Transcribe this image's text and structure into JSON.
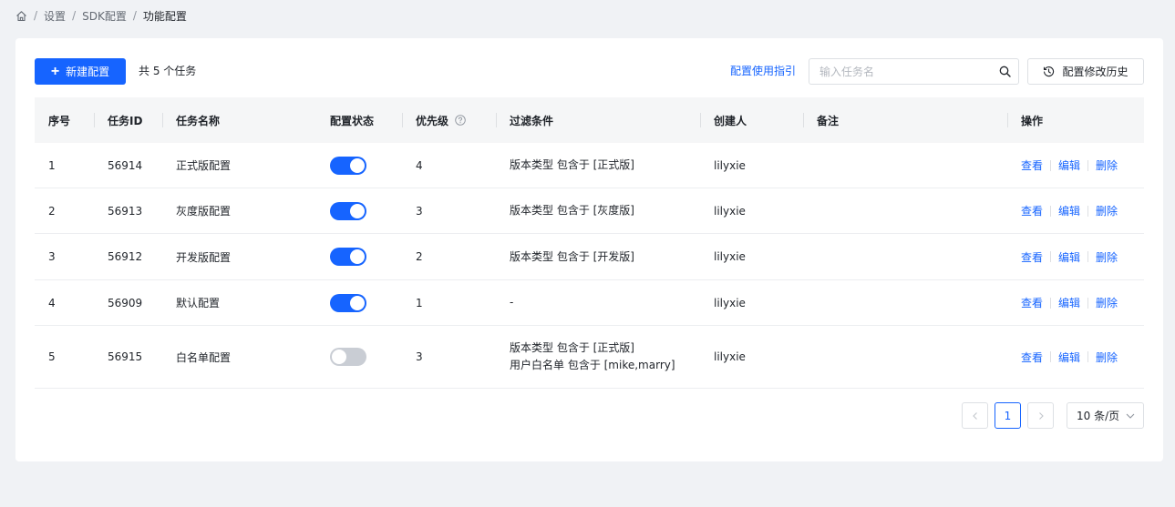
{
  "breadcrumb": {
    "items": [
      "设置",
      "SDK配置"
    ],
    "current": "功能配置",
    "separator": "/"
  },
  "toolbar": {
    "new_label": "新建配置",
    "total_text": "共 5 个任务",
    "guide_label": "配置使用指引",
    "search_placeholder": "输入任务名",
    "history_label": "配置修改历史"
  },
  "table": {
    "columns": [
      "序号",
      "任务ID",
      "任务名称",
      "配置状态",
      "优先级",
      "过滤条件",
      "创建人",
      "备注",
      "操作"
    ],
    "rows": [
      {
        "index": "1",
        "id": "56914",
        "name": "正式版配置",
        "enabled": true,
        "priority": "4",
        "filters": [
          "版本类型 包含于 [正式版]"
        ],
        "creator": "lilyxie",
        "note": ""
      },
      {
        "index": "2",
        "id": "56913",
        "name": "灰度版配置",
        "enabled": true,
        "priority": "3",
        "filters": [
          "版本类型 包含于 [灰度版]"
        ],
        "creator": "lilyxie",
        "note": ""
      },
      {
        "index": "3",
        "id": "56912",
        "name": "开发版配置",
        "enabled": true,
        "priority": "2",
        "filters": [
          "版本类型 包含于 [开发版]"
        ],
        "creator": "lilyxie",
        "note": ""
      },
      {
        "index": "4",
        "id": "56909",
        "name": "默认配置",
        "enabled": true,
        "priority": "1",
        "filters": [
          "-"
        ],
        "creator": "lilyxie",
        "note": ""
      },
      {
        "index": "5",
        "id": "56915",
        "name": "白名单配置",
        "enabled": false,
        "priority": "3",
        "filters": [
          "版本类型 包含于 [正式版]",
          "用户白名单 包含于 [mike,marry]"
        ],
        "creator": "lilyxie",
        "note": ""
      }
    ],
    "actions": {
      "view": "查看",
      "edit": "编辑",
      "delete": "删除"
    }
  },
  "pagination": {
    "current_page": "1",
    "page_size": "10 条/页"
  },
  "colors": {
    "primary": "#1664ff",
    "toggle_off": "#c9cdd4",
    "background": "#f0f2f5"
  },
  "icons": {
    "home": "home-icon",
    "plus": "plus-icon",
    "search": "search-icon",
    "history": "history-icon",
    "help": "question-circle-icon"
  }
}
